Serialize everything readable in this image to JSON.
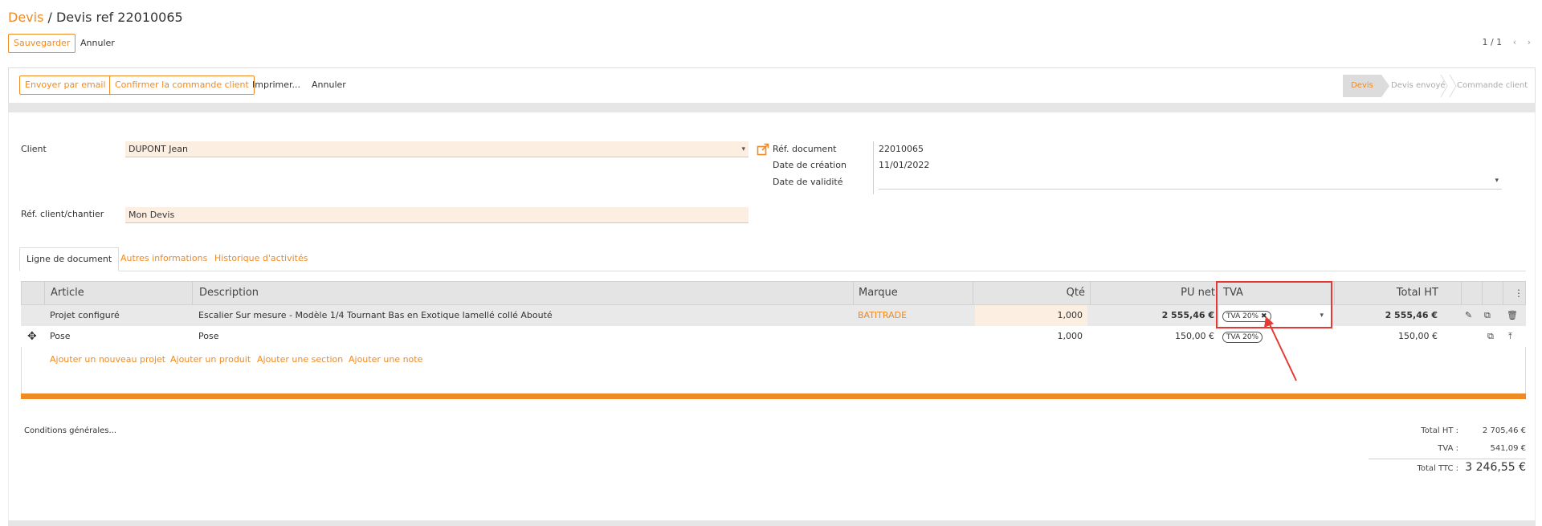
{
  "breadcrumb": {
    "root": "Devis",
    "separator": " / ",
    "current": "Devis ref 22010065"
  },
  "control_bar": {
    "save_label": "Sauvegarder",
    "cancel_label": "Annuler",
    "pager": "1 / 1",
    "prev_icon": "chevron-left",
    "next_icon": "chevron-right"
  },
  "action_bar": {
    "send_email": "Envoyer par email",
    "confirm_order": "Confirmer la commande client",
    "print": "Imprimer...",
    "cancel": "Annuler"
  },
  "status_bar": {
    "steps": [
      "Devis",
      "Devis envoyé",
      "Commande client"
    ],
    "active": "Devis"
  },
  "form": {
    "client_label": "Client",
    "client_value": "DUPONT Jean",
    "ref_label": "Réf. client/chantier",
    "ref_value": "Mon Devis",
    "doc_ref_label": "Réf. document",
    "doc_ref_value": "22010065",
    "creation_label": "Date de création",
    "creation_value": "11/01/2022",
    "validity_label": "Date de validité",
    "validity_value": ""
  },
  "tabs": [
    "Ligne de document",
    "Autres informations",
    "Historique d'activités"
  ],
  "table": {
    "headers": {
      "article": "Article",
      "description": "Description",
      "brand": "Marque",
      "qty": "Qté",
      "unit_price": "PU net",
      "tva": "TVA",
      "total": "Total HT"
    },
    "rows": [
      {
        "article": "Projet configuré",
        "description": "Escalier Sur mesure - Modèle 1/4 Tournant Bas en Exotique lamellé collé Abouté",
        "brand": "BATITRADE",
        "qty": "1,000",
        "unit_price": "2 555,46 €",
        "tva": "TVA 20%",
        "total": "2 555,46 €"
      },
      {
        "article": "Pose",
        "description": "Pose",
        "brand": "",
        "qty": "1,000",
        "unit_price": "150,00 €",
        "tva": "TVA 20%",
        "total": "150,00 €"
      }
    ],
    "add_links": [
      "Ajouter un nouveau projet",
      "Ajouter un produit",
      "Ajouter une section",
      "Ajouter une note"
    ]
  },
  "footer": {
    "conditions": "Conditions générales...",
    "total_ht_label": "Total HT :",
    "total_ht": "2 705,46 €",
    "tva_label": "TVA :",
    "tva": "541,09 €",
    "total_ttc_label": "Total TTC :",
    "total_ttc": "3 246,55 €"
  },
  "colors": {
    "accent": "#F08A24",
    "highlight_box": "#e53935",
    "field_bg": "#FDEEE2"
  }
}
